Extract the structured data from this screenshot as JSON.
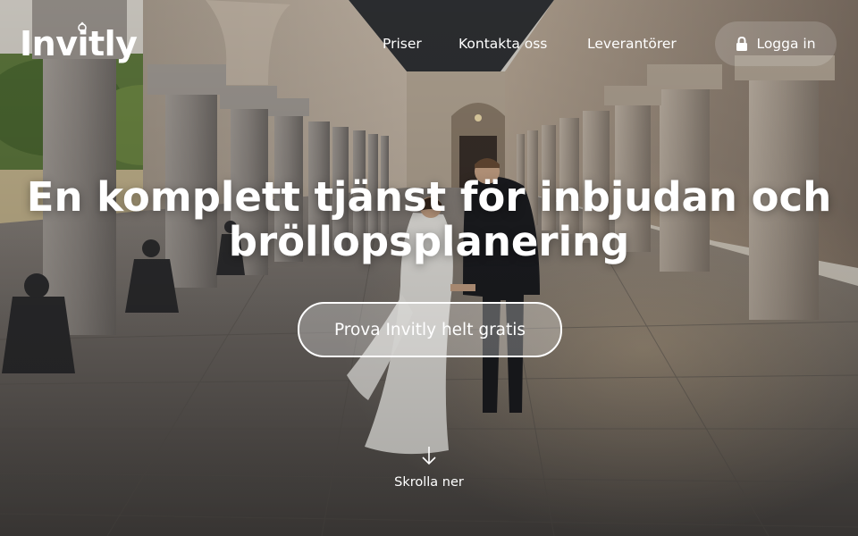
{
  "brand": {
    "logo_text": "Invitly"
  },
  "nav": {
    "items": [
      {
        "label": "Priser"
      },
      {
        "label": "Kontakta oss"
      },
      {
        "label": "Leverantörer"
      }
    ],
    "login": {
      "label": "Logga in",
      "icon": "lock-icon"
    }
  },
  "hero": {
    "headline_line1": "En komplett tjänst för inbjudan och",
    "headline_line2": "bröllopsplanering",
    "cta_label": "Prova Invitly helt gratis",
    "scroll_label": "Skrolla ner",
    "scroll_icon": "arrow-down-icon"
  },
  "colors": {
    "text": "#ffffff",
    "button_fill": "rgba(255,255,255,0.28)",
    "login_fill": "rgba(255,255,255,0.16)"
  }
}
